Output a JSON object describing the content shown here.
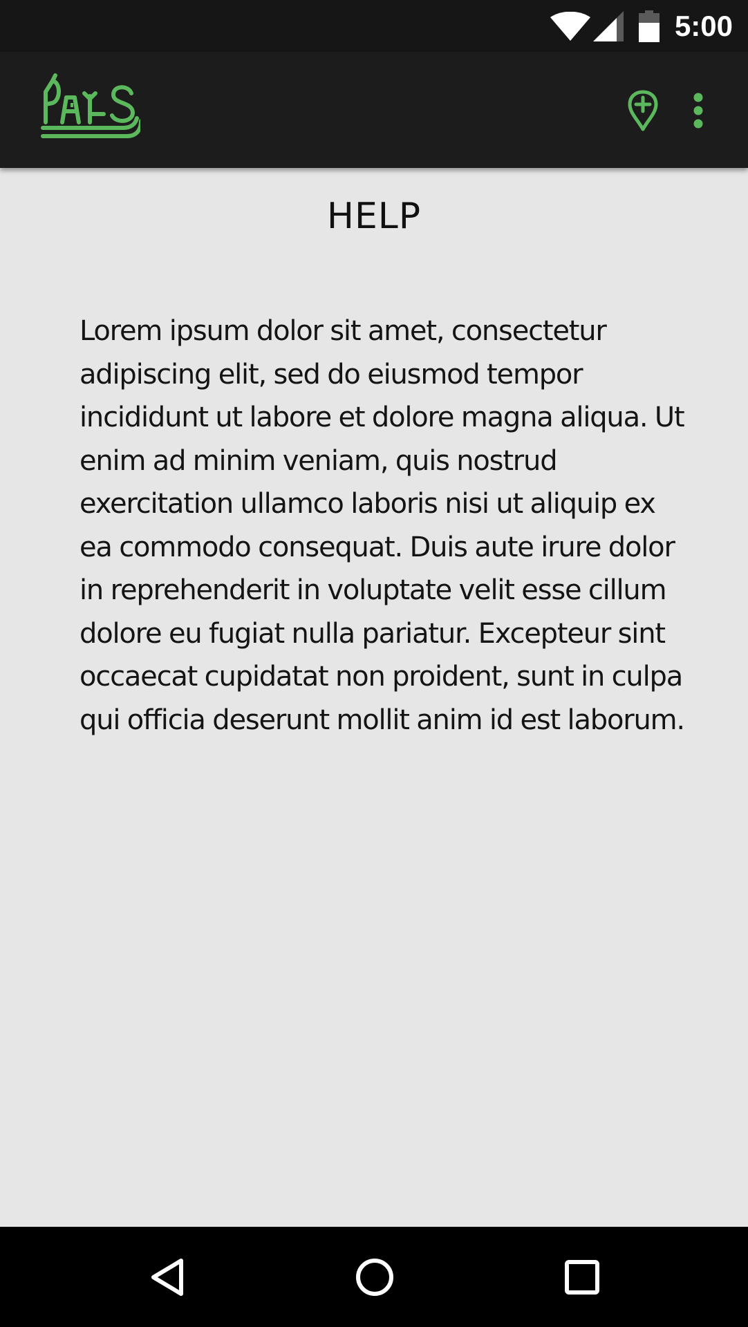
{
  "status_bar": {
    "time": "5:00",
    "icons": [
      "wifi-icon",
      "cell-signal-icon",
      "battery-icon"
    ]
  },
  "app_bar": {
    "logo_text": "PAIS",
    "actions": [
      {
        "name": "add-location",
        "icon": "map-marker-plus-icon"
      },
      {
        "name": "overflow-menu",
        "icon": "more-vertical-icon"
      }
    ]
  },
  "content": {
    "title": "HELP",
    "body": "Lorem ipsum dolor sit amet, consectetur adipiscing elit, sed do eiusmod tempor incididunt ut labore et dolore magna aliqua. Ut enim ad minim veniam, quis nostrud exercitation ullamco laboris nisi ut aliquip ex ea commodo consequat. Duis aute irure dolor in reprehenderit in voluptate velit esse cillum dolore eu fugiat nulla pariatur. Excepteur sint occaecat cupidatat non proident, sunt in culpa qui officia deserunt mollit anim id est laborum."
  },
  "nav_bar": {
    "buttons": [
      "back-icon",
      "home-icon",
      "recents-icon"
    ]
  },
  "colors": {
    "accent_green": "#5cb85c",
    "status_bar_bg": "#161616",
    "app_bar_bg": "#1c1c1c",
    "content_bg": "#e6e6e6",
    "nav_bar_bg": "#000000"
  }
}
